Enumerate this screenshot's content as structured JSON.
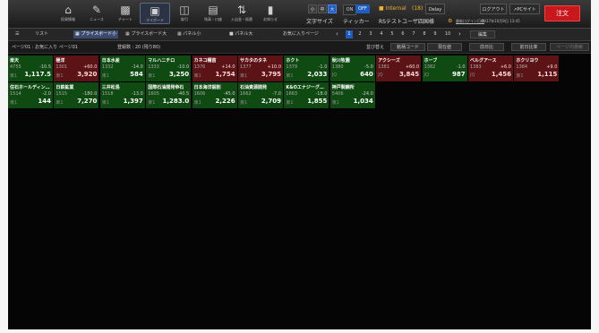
{
  "colors": {
    "order": "#c8181c",
    "tile_up": "#5b1316",
    "tile_down": "#0f4a12",
    "page_selected": "#1f5dbf"
  },
  "nav": [
    {
      "label": "投資情報",
      "icon": "home-icon"
    },
    {
      "label": "ニュース",
      "icon": "news-icon"
    },
    {
      "label": "チャート",
      "icon": "chart-icon"
    },
    {
      "label": "マイボード",
      "icon": "myboard-icon"
    },
    {
      "label": "取引",
      "icon": "book-icon"
    },
    {
      "label": "残高・口座",
      "icon": "balance-icon"
    },
    {
      "label": "入出金・振替",
      "icon": "transfer-icon"
    },
    {
      "label": "お知らせ",
      "icon": "notice-icon"
    }
  ],
  "font_size": {
    "label": "文字サイズ",
    "small": "小",
    "medium": "中",
    "large": "大"
  },
  "ticker": {
    "label": "ティッカー",
    "on": "ON",
    "off": "OFF"
  },
  "realtime": {
    "internal": "Internal",
    "count": "(18)",
    "delay": "Delay"
  },
  "user": {
    "name": "RSテストユーザ四国様",
    "note": "最新ログイン日時",
    "datetime": "2017年10月9日 13:45"
  },
  "buttons": {
    "logout": "ログアウト",
    "pc_site": "PCサイト",
    "order": "注文"
  },
  "view_tabs": {
    "list": "リスト",
    "price_small": "プライスボード小",
    "price_large": "プライスボード大",
    "panel_small": "パネル小",
    "panel_large": "パネル大",
    "favorites": "お気に入りページ",
    "edit": "編集"
  },
  "pages": [
    "1",
    "2",
    "3",
    "4",
    "5",
    "6",
    "7",
    "8",
    "9",
    "10"
  ],
  "selected_page": "1",
  "subheader": {
    "page": "ページ01 : お気に入り ページ01",
    "count": "登録数 : 20 (残り80)",
    "sort_label": "並び替え",
    "sort_buttons": [
      "銘柄コード",
      "現在値",
      "前日比",
      "前日比率",
      "ページ内検索"
    ]
  },
  "tiles": [
    {
      "name": "楽天",
      "code": "4755",
      "change": "-10.5",
      "exchange": "東1",
      "price": "1,117.5",
      "tone": "down"
    },
    {
      "name": "極洋",
      "code": "1301",
      "change": "+60.0",
      "exchange": "東1",
      "price": "3,920",
      "tone": "up"
    },
    {
      "name": "日本水産",
      "code": "1332",
      "change": "-14.0",
      "exchange": "東1",
      "price": "584",
      "tone": "down"
    },
    {
      "name": "マルハニチロ",
      "code": "1333",
      "change": "-10.0",
      "exchange": "東1",
      "price": "3,250",
      "tone": "down"
    },
    {
      "name": "カネコ種苗",
      "code": "1376",
      "change": "+14.0",
      "exchange": "東1",
      "price": "1,754",
      "tone": "up"
    },
    {
      "name": "サカタのタネ",
      "code": "1377",
      "change": "+10.0",
      "exchange": "東1",
      "price": "3,795",
      "tone": "up"
    },
    {
      "name": "ホクト",
      "code": "1379",
      "change": "-1.0",
      "exchange": "東1",
      "price": "2,033",
      "tone": "down"
    },
    {
      "name": "秋川牧園",
      "code": "1380",
      "change": "-5.0",
      "exchange": "JQ",
      "price": "640",
      "tone": "down"
    },
    {
      "name": "アクシーズ",
      "code": "1381",
      "change": "+60.0",
      "exchange": "JQ",
      "price": "3,845",
      "tone": "up"
    },
    {
      "name": "ホーブ",
      "code": "1382",
      "change": "-1.0",
      "exchange": "JQ",
      "price": "987",
      "tone": "down"
    },
    {
      "name": "ベルグアース",
      "code": "1383",
      "change": "+6.0",
      "exchange": "JQ",
      "price": "1,456",
      "tone": "up"
    },
    {
      "name": "ホクリヨウ",
      "code": "1384",
      "change": "+9.0",
      "exchange": "東1",
      "price": "1,115",
      "tone": "up"
    },
    {
      "name": "住石ホールディン…",
      "code": "1514",
      "change": "-2.0",
      "exchange": "東1",
      "price": "144",
      "tone": "down"
    },
    {
      "name": "日鉄鉱業",
      "code": "1515",
      "change": "-180.0",
      "exchange": "東1",
      "price": "7,270",
      "tone": "down"
    },
    {
      "name": "三井松島",
      "code": "1518",
      "change": "-13.0",
      "exchange": "東1",
      "price": "1,397",
      "tone": "down"
    },
    {
      "name": "国際石油開発帝石",
      "code": "1605",
      "change": "-40.5",
      "exchange": "東1",
      "price": "1,283.0",
      "tone": "down"
    },
    {
      "name": "日本海洋掘削",
      "code": "1606",
      "change": "-45.0",
      "exchange": "東1",
      "price": "2,226",
      "tone": "down"
    },
    {
      "name": "石油資源開発",
      "code": "1662",
      "change": "-7.0",
      "exchange": "東1",
      "price": "2,709",
      "tone": "down"
    },
    {
      "name": "K&Oエナジーグ…",
      "code": "1663",
      "change": "-18.0",
      "exchange": "東1",
      "price": "1,855",
      "tone": "down"
    },
    {
      "name": "神戸製鋼所",
      "code": "5406",
      "change": "-24.0",
      "exchange": "東1",
      "price": "1,034",
      "tone": "down"
    }
  ]
}
